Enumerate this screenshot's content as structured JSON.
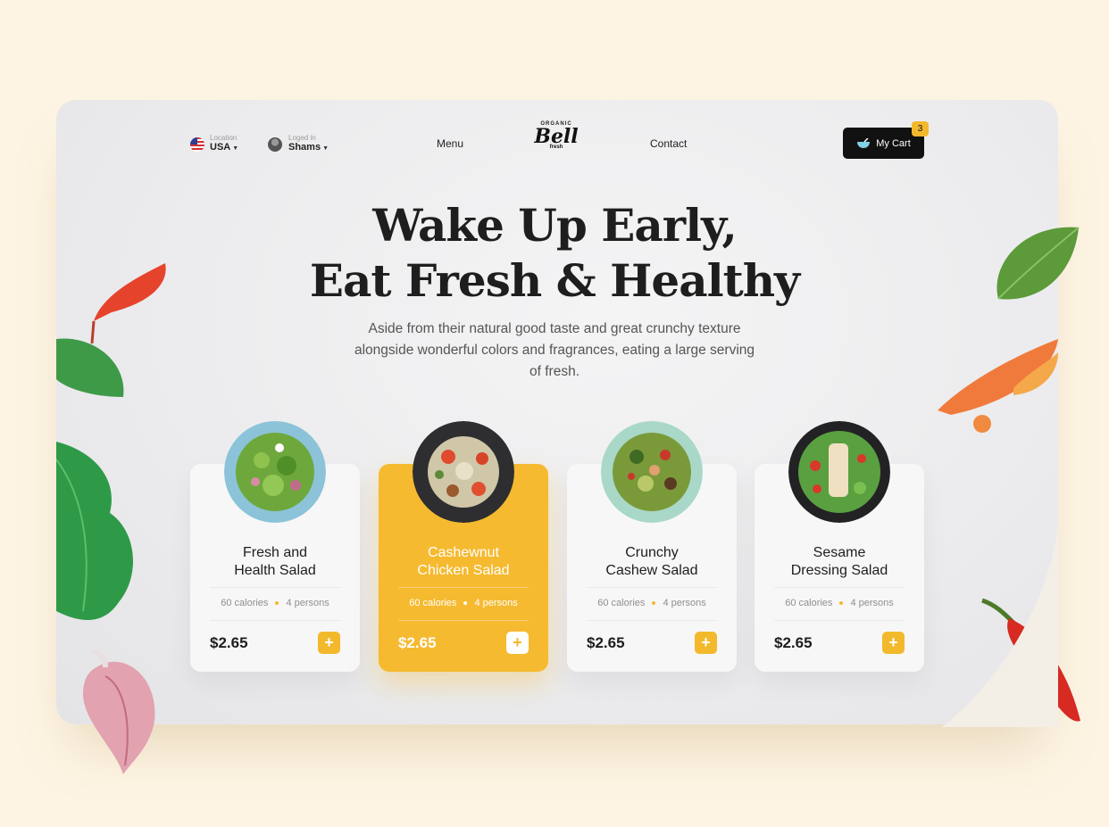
{
  "nav": {
    "location_label": "Location",
    "location_value": "USA",
    "login_label": "Loged in",
    "login_value": "Shams",
    "menu": "Menu",
    "contact": "Contact",
    "logo_top": "ORGANIC",
    "logo_main": "Bell",
    "logo_sub": "fresh",
    "cart_label": "My Cart",
    "cart_count": "3"
  },
  "hero": {
    "title_line1": "Wake Up Early,",
    "title_line2": "Eat Fresh & Healthy",
    "subtitle": "Aside from their natural good taste and great crunchy texture alongside wonderful colors and fragrances, eating a large serving of fresh."
  },
  "cards": [
    {
      "title": "Fresh and Health Salad",
      "calories": "60 calories",
      "persons": "4 persons",
      "price": "$2.65",
      "add": "+"
    },
    {
      "title": "Cashewnut Chicken Salad",
      "calories": "60 calories",
      "persons": "4 persons",
      "price": "$2.65",
      "add": "+"
    },
    {
      "title": "Crunchy Cashew Salad",
      "calories": "60 calories",
      "persons": "4 persons",
      "price": "$2.65",
      "add": "+"
    },
    {
      "title": "Sesame Dressing Salad",
      "calories": "60 calories",
      "persons": "4 persons",
      "price": "$2.65",
      "add": "+"
    }
  ],
  "colors": {
    "accent": "#f3b92c",
    "dark": "#111111",
    "background": "#fdf4e3"
  }
}
